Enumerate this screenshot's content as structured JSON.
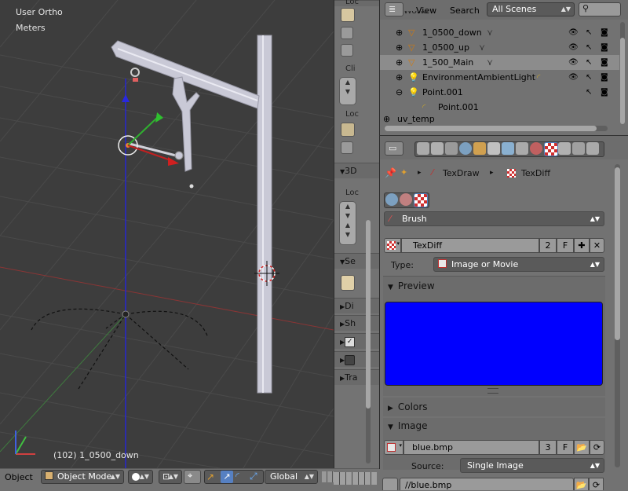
{
  "viewport": {
    "view_name": "User Ortho",
    "units": "Meters",
    "object_status": "(102) 1_0500_down"
  },
  "bottom_bar": {
    "object_label": "Object",
    "mode": "Object Mode",
    "orientation": "Global"
  },
  "toolshelf": {
    "tab1": "Loc",
    "tab2": "Cli",
    "tab3": "Loc",
    "panel_3d": "3D",
    "loc2": "Loc",
    "panel_se": "Se",
    "panel_di": "Di",
    "panel_sh": "Sh",
    "panel_tra": "Tra"
  },
  "outliner": {
    "view_label": "View",
    "search_label": "Search",
    "scene_filter": "All Scenes",
    "partial_top": "World",
    "rows": [
      {
        "name": "1_0500_down",
        "type": "mesh"
      },
      {
        "name": "1_0500_up",
        "type": "mesh"
      },
      {
        "name": "1_500_Main",
        "type": "mesh"
      },
      {
        "name": "EnvironmentAmbientLight",
        "type": "lamp"
      },
      {
        "name": "Point.001",
        "type": "lamp"
      },
      {
        "name": "Point.001",
        "type": "lamp-data"
      }
    ],
    "partial_bottom": "uv_temp"
  },
  "properties": {
    "breadcrumb_draw": "TexDraw",
    "breadcrumb_tex": "TexDiff",
    "brush_selector": "Brush",
    "texture_name": "TexDiff",
    "texture_users": "2",
    "fake_user": "F",
    "type_label": "Type:",
    "type_value": "Image or Movie",
    "preview_label": "Preview",
    "preview_color": "#0000ff",
    "colors_label": "Colors",
    "image_label": "Image",
    "image_name": "blue.bmp",
    "image_users": "3",
    "image_fake": "F",
    "source_label": "Source:",
    "source_value": "Single Image",
    "file_path": "//blue.bmp"
  }
}
